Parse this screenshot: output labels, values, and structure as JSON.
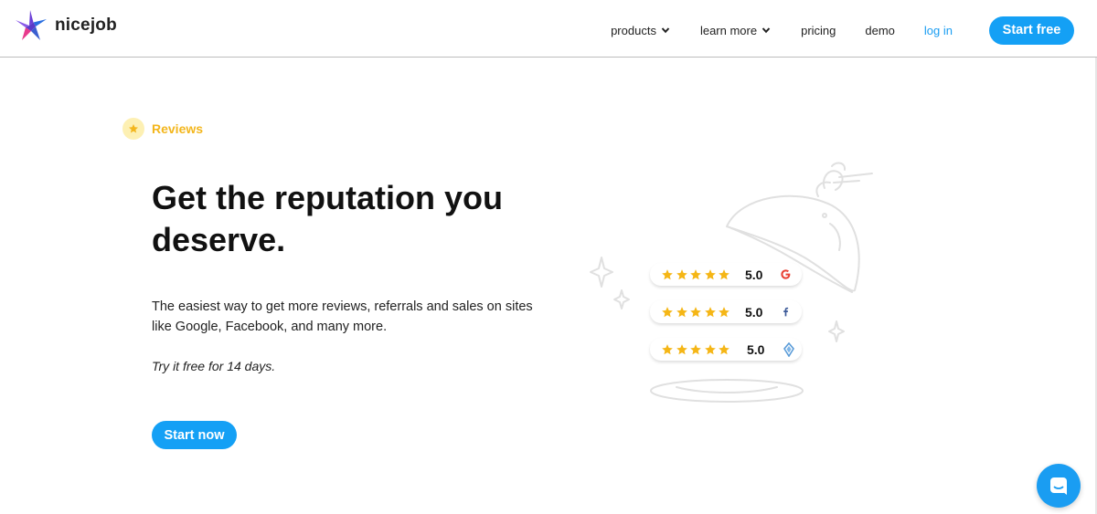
{
  "brand": {
    "name": "nicejob",
    "accent": "#14a0f5",
    "logo_colors": [
      "#6b3fd6",
      "#2a6fe0",
      "#e83a8c"
    ]
  },
  "nav": {
    "products": "products",
    "learn_more": "learn more",
    "pricing": "pricing",
    "demo": "demo",
    "login": "log in",
    "start_free": "Start free"
  },
  "hero": {
    "eyebrow": "Reviews",
    "eyebrow_color": "#f3b61c",
    "headline": "Get the reputation you deserve.",
    "subtext": "The easiest way to get more reviews, referrals and sales on sites like Google, Facebook, and many more.",
    "trial": "Try it free for 14 days.",
    "cta": "Start now"
  },
  "ratings": [
    {
      "stars": 5,
      "score": "5.0",
      "source_icon": "google-icon"
    },
    {
      "stars": 5,
      "score": "5.0",
      "source_icon": "facebook-icon"
    },
    {
      "stars": 5,
      "score": "5.0",
      "source_icon": "gem-icon"
    }
  ],
  "chat": {
    "icon": "chat-icon"
  }
}
